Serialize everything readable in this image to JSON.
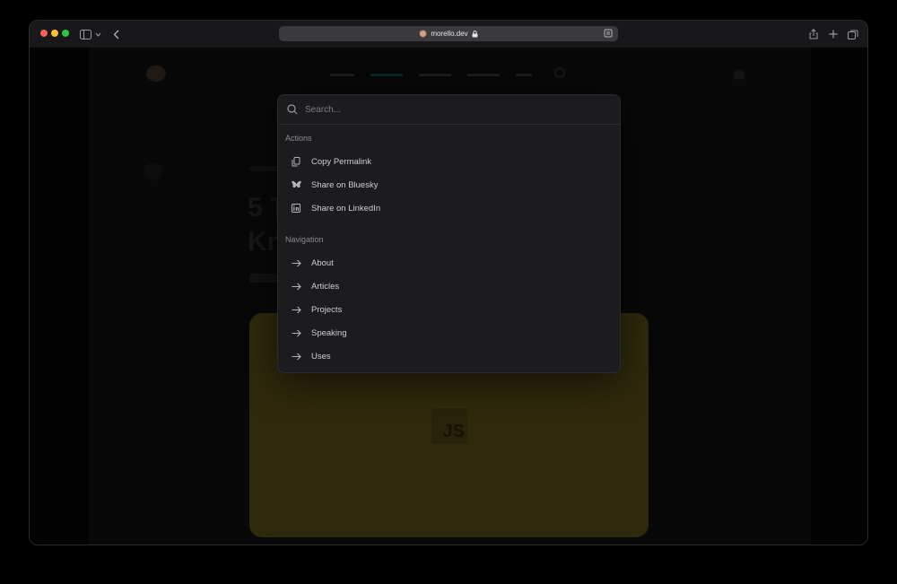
{
  "browser": {
    "url": "morello.dev"
  },
  "site_background": {
    "headline_line1": "5 T",
    "headline_line2": "Kn",
    "hero_badge": "JS"
  },
  "palette": {
    "search_placeholder": "Search...",
    "groups": [
      {
        "title": "Actions",
        "items": [
          {
            "label": "Copy Permalink",
            "icon": "copy-icon"
          },
          {
            "label": "Share on Bluesky",
            "icon": "bluesky-icon"
          },
          {
            "label": "Share on LinkedIn",
            "icon": "linkedin-icon"
          }
        ]
      },
      {
        "title": "Navigation",
        "items": [
          {
            "label": "About",
            "icon": "arrow-right-icon"
          },
          {
            "label": "Articles",
            "icon": "arrow-right-icon"
          },
          {
            "label": "Projects",
            "icon": "arrow-right-icon"
          },
          {
            "label": "Speaking",
            "icon": "arrow-right-icon"
          },
          {
            "label": "Uses",
            "icon": "arrow-right-icon"
          }
        ]
      }
    ]
  },
  "colors": {
    "accent_hero": "#564d16",
    "palette_bg": "#1c1c1f"
  }
}
